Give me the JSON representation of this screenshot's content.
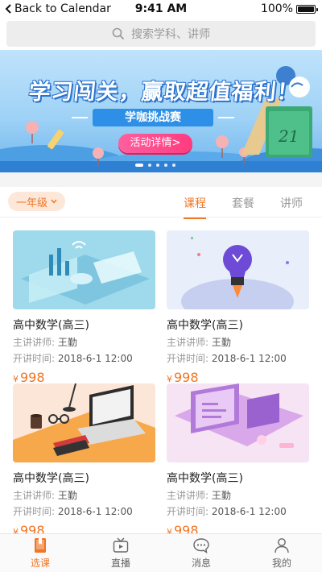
{
  "status_bar": {
    "back_label": "Back to Calendar",
    "time": "9:41 AM",
    "battery": "100%"
  },
  "search": {
    "placeholder": "搜索学科、讲师"
  },
  "banner": {
    "headline": "学习闯关，赢取超值福利！",
    "subtitle": "学咖挑战赛",
    "cta": "活动详情>",
    "calendar_number": "21",
    "slides": 5,
    "active_slide": 1
  },
  "filter": {
    "grade": "一年级"
  },
  "tabs": [
    {
      "label": "课程",
      "active": true
    },
    {
      "label": "套餐",
      "active": false
    },
    {
      "label": "讲师",
      "active": false
    }
  ],
  "courses": [
    {
      "title": "高中数学(高三)",
      "teacher_label": "主讲讲师:",
      "teacher": "王勤",
      "time_label": "开讲时间:",
      "time": "2018-6-1 12:00",
      "currency": "¥",
      "price": "998",
      "thumb": "isometric-tech-illustration"
    },
    {
      "title": "高中数学(高三)",
      "teacher_label": "主讲讲师:",
      "teacher": "王勤",
      "time_label": "开讲时间:",
      "time": "2018-6-1 12:00",
      "currency": "¥",
      "price": "998",
      "thumb": "lightbulb-rocket-illustration"
    },
    {
      "title": "高中数学(高三)",
      "teacher_label": "主讲讲师:",
      "teacher": "王勤",
      "time_label": "开讲时间:",
      "time": "2018-6-1 12:00",
      "currency": "¥",
      "price": "998",
      "thumb": "desk-laptop-illustration"
    },
    {
      "title": "高中数学(高三)",
      "teacher_label": "主讲讲师:",
      "teacher": "王勤",
      "time_label": "开讲时间:",
      "time": "2018-6-1 12:00",
      "currency": "¥",
      "price": "998",
      "thumb": "isometric-screens-illustration"
    }
  ],
  "nav": [
    {
      "label": "选课",
      "icon": "book-icon",
      "active": true
    },
    {
      "label": "直播",
      "icon": "tv-icon",
      "active": false
    },
    {
      "label": "消息",
      "icon": "chat-bubble-icon",
      "active": false
    },
    {
      "label": "我的",
      "icon": "person-icon",
      "active": false
    }
  ],
  "colors": {
    "accent": "#f07524",
    "banner_blue": "#2d8fe6",
    "cta_pink": "#ff3b7f"
  }
}
